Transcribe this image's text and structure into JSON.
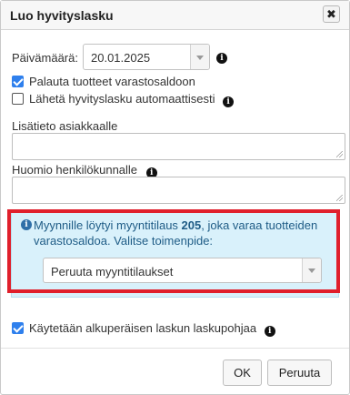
{
  "dialog": {
    "title": "Luo hyvityslasku",
    "close_label": "✖"
  },
  "date": {
    "label": "Päivämäärä:",
    "value": "20.01.2025"
  },
  "checkboxes": [
    {
      "label": "Palauta tuotteet varastosaldoon",
      "checked": true
    },
    {
      "label": "Lähetä hyvityslasku automaattisesti",
      "checked": false
    }
  ],
  "customer_note": {
    "label": "Lisätieto asiakkaalle",
    "value": ""
  },
  "staff_note": {
    "label": "Huomio henkilökunnalle",
    "value": ""
  },
  "info": {
    "text_before": "Myynnille löytyi myyntitilaus ",
    "order_number": "205",
    "text_after": ", joka varaa tuotteiden varastosaldoa. Valitse toimenpide:",
    "action_selected": "Peruuta myyntitilaukset"
  },
  "template_checkbox": {
    "label": "Käytetään alkuperäisen laskun laskupohjaa",
    "checked": true
  },
  "buttons": {
    "ok": "OK",
    "cancel": "Peruuta"
  },
  "colors": {
    "info_bg": "#d9f1fb",
    "info_text": "#1f5c86",
    "highlight": "#e0202c",
    "checkbox_on": "#2f80ed"
  }
}
